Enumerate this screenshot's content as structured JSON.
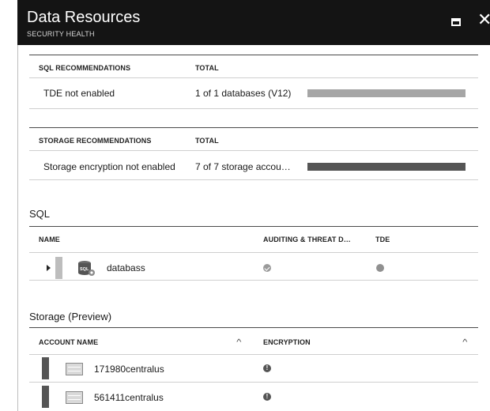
{
  "header": {
    "title": "Data Resources",
    "subtitle": "SECURITY HEALTH"
  },
  "sql_recommendations": {
    "col1": "SQL RECOMMENDATIONS",
    "col2": "TOTAL",
    "rows": [
      {
        "name": "TDE not enabled",
        "total": "1 of 1 databases (V12)",
        "progress": 1.0,
        "bar_color": "#a6a6a6"
      }
    ]
  },
  "storage_recommendations": {
    "col1": "STORAGE RECOMMENDATIONS",
    "col2": "TOTAL",
    "rows": [
      {
        "name": "Storage encryption not enabled",
        "total": "7 of 7 storage accou…",
        "progress": 1.0,
        "bar_color": "#555555"
      }
    ]
  },
  "sql": {
    "title": "SQL",
    "col_name": "NAME",
    "col_auditing": "AUDITING & THREAT D…",
    "col_tde": "TDE",
    "rows": [
      {
        "name": "databass",
        "icon": "sql-database-icon",
        "auditing_icon": "check-circle-icon",
        "tde_icon": "gray-dot-icon"
      }
    ]
  },
  "storage": {
    "title": "Storage (Preview)",
    "col_account": "ACCOUNT NAME",
    "col_encryption": "ENCRYPTION",
    "rows": [
      {
        "name": "171980centralus",
        "icon": "storage-account-icon",
        "encryption_icon": "info-icon"
      },
      {
        "name": "561411centralus",
        "icon": "storage-account-icon",
        "encryption_icon": "info-icon"
      }
    ]
  },
  "icon_glyphs": {
    "close": "✕",
    "chevron_up": "^",
    "info": "!"
  },
  "colors": {
    "header_bg": "#141414",
    "accent": "#555555",
    "light_bar": "#a6a6a6"
  }
}
